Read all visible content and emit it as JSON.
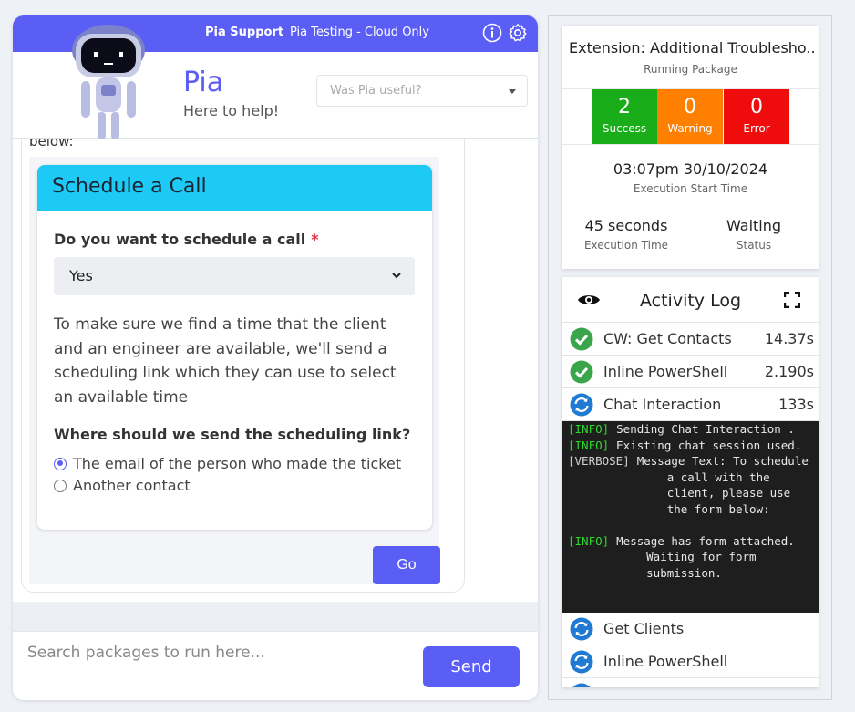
{
  "chat": {
    "topbar": {
      "brand": "Pia Support",
      "tenant": "Pia Testing - Cloud Only"
    },
    "header": {
      "name": "Pia",
      "tagline": "Here to help!",
      "feedback_placeholder": "Was Pia useful?"
    },
    "message_fragment": "below:",
    "form": {
      "title": "Schedule a Call",
      "question1": "Do you want to schedule a call",
      "question1_required": "*",
      "question1_value": "Yes",
      "paragraph": "To make sure we find a time that the client and an engineer are available, we'll send a scheduling link which they can use to select an available time",
      "question2": "Where should we send the scheduling link?",
      "options": [
        {
          "label": "The email of the person who made the ticket",
          "selected": true
        },
        {
          "label": "Another contact",
          "selected": false
        }
      ],
      "submit_label": "Go"
    },
    "composer": {
      "placeholder": "Search packages to run here...",
      "send_label": "Send"
    }
  },
  "package": {
    "title": "Extension: Additional Troublesho...",
    "subtitle": "Running Package",
    "stats": {
      "success": {
        "count": "2",
        "label": "Success",
        "color": "#1aad1a"
      },
      "warning": {
        "count": "0",
        "label": "Warning",
        "color": "#ff7f00"
      },
      "error": {
        "count": "0",
        "label": "Error",
        "color": "#ee0c0c"
      }
    },
    "start_time": "03:07pm 30/10/2024",
    "start_time_label": "Execution Start Time",
    "execution_time": "45 seconds",
    "execution_time_label": "Execution Time",
    "status": "Waiting",
    "status_label": "Status"
  },
  "activity_log": {
    "title": "Activity Log",
    "items": [
      {
        "name": "CW: Get Contacts",
        "time": "14.37s",
        "state": "check-circle-icon"
      },
      {
        "name": "Inline PowerShell",
        "time": "2.190s",
        "state": "check-circle-icon"
      },
      {
        "name": "Chat Interaction",
        "time": "133s",
        "state": "sync-icon"
      }
    ],
    "console": [
      {
        "tag": "[INFO]",
        "text": "Sending Chat Interaction ."
      },
      {
        "tag": "[INFO]",
        "text": "Existing chat session used."
      },
      {
        "tag": "[VERBOSE]",
        "text": "Message Text: To schedule a call with the client, please use the form below:"
      },
      {
        "tag": "",
        "text": ""
      },
      {
        "tag": "[INFO]",
        "text": "Message has form attached. Waiting for form submission."
      }
    ],
    "pending_items": [
      {
        "name": "Get Clients",
        "state": "sync-icon"
      },
      {
        "name": "Inline PowerShell",
        "state": "sync-icon"
      }
    ]
  }
}
